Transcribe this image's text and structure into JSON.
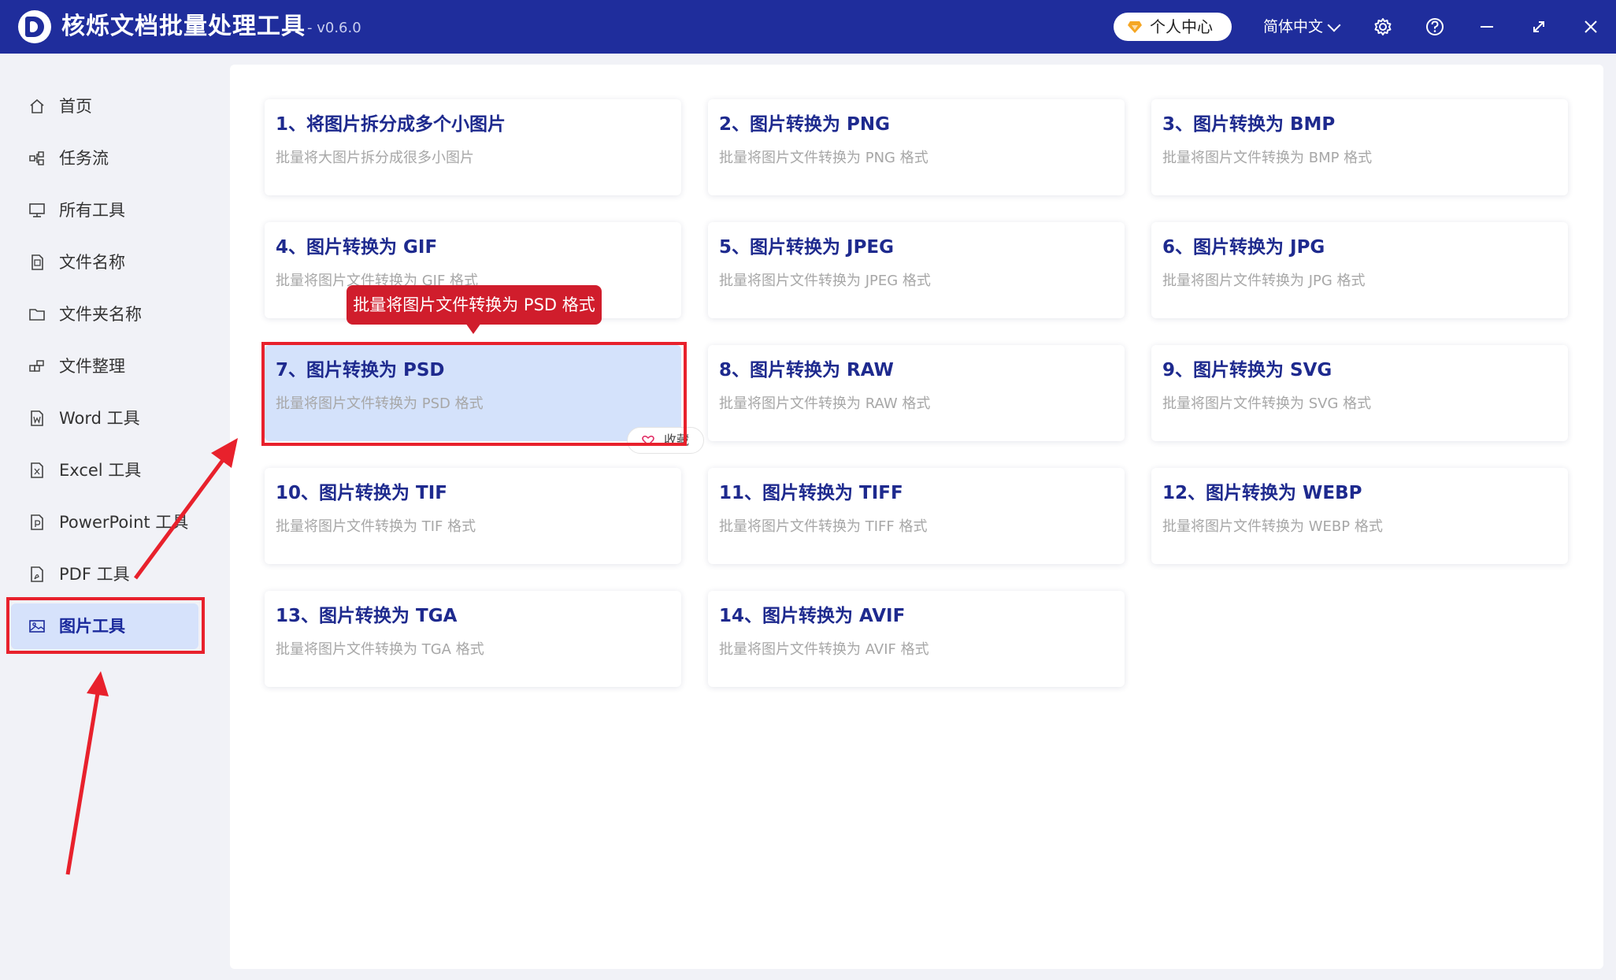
{
  "app": {
    "title": "核烁文档批量处理工具",
    "version": "- v0.6.0",
    "profile_label": "个人中心",
    "language_label": "简体中文"
  },
  "icons": {
    "settings": "gear-icon",
    "help": "help-circle-icon",
    "minimize": "minimize-icon",
    "maximize": "maximize-icon",
    "close": "close-icon"
  },
  "sidebar": {
    "items": [
      {
        "label": "首页",
        "icon": "home-icon"
      },
      {
        "label": "任务流",
        "icon": "workflow-icon"
      },
      {
        "label": "所有工具",
        "icon": "monitor-icon"
      },
      {
        "label": "文件名称",
        "icon": "file-icon"
      },
      {
        "label": "文件夹名称",
        "icon": "folder-icon"
      },
      {
        "label": "文件整理",
        "icon": "organize-icon"
      },
      {
        "label": "Word 工具",
        "icon": "word-icon"
      },
      {
        "label": "Excel 工具",
        "icon": "excel-icon"
      },
      {
        "label": "PowerPoint 工具",
        "icon": "powerpoint-icon"
      },
      {
        "label": "PDF 工具",
        "icon": "pdf-icon"
      },
      {
        "label": "图片工具",
        "icon": "image-icon",
        "active": true
      }
    ]
  },
  "tools": [
    {
      "title": "1、将图片拆分成多个小图片",
      "desc": "批量将大图片拆分成很多小图片"
    },
    {
      "title": "2、图片转换为 PNG",
      "desc": "批量将图片文件转换为 PNG 格式"
    },
    {
      "title": "3、图片转换为 BMP",
      "desc": "批量将图片文件转换为 BMP 格式"
    },
    {
      "title": "4、图片转换为 GIF",
      "desc": "批量将图片文件转换为 GIF 格式"
    },
    {
      "title": "5、图片转换为 JPEG",
      "desc": "批量将图片文件转换为 JPEG 格式"
    },
    {
      "title": "6、图片转换为 JPG",
      "desc": "批量将图片文件转换为 JPG 格式"
    },
    {
      "title": "7、图片转换为 PSD",
      "desc": "批量将图片文件转换为 PSD 格式"
    },
    {
      "title": "8、图片转换为 RAW",
      "desc": "批量将图片文件转换为 RAW 格式"
    },
    {
      "title": "9、图片转换为 SVG",
      "desc": "批量将图片文件转换为 SVG 格式"
    },
    {
      "title": "10、图片转换为 TIF",
      "desc": "批量将图片文件转换为 TIF 格式"
    },
    {
      "title": "11、图片转换为 TIFF",
      "desc": "批量将图片文件转换为 TIFF 格式"
    },
    {
      "title": "12、图片转换为 WEBP",
      "desc": "批量将图片文件转换为 WEBP 格式"
    },
    {
      "title": "13、图片转换为 TGA",
      "desc": "批量将图片文件转换为 TGA 格式"
    },
    {
      "title": "14、图片转换为 AVIF",
      "desc": "批量将图片文件转换为 AVIF 格式"
    }
  ],
  "hover": {
    "tooltip": "批量将图片文件转换为 PSD 格式",
    "favorite_label": "收藏"
  },
  "colors": {
    "titlebar": "#1f2d9c",
    "accent_text": "#1e2a8e",
    "active_nav": "#d6e2fb",
    "hover_card": "#d4e2fb",
    "annotation_red": "#e8212c",
    "tooltip_red": "#d01d2c"
  }
}
